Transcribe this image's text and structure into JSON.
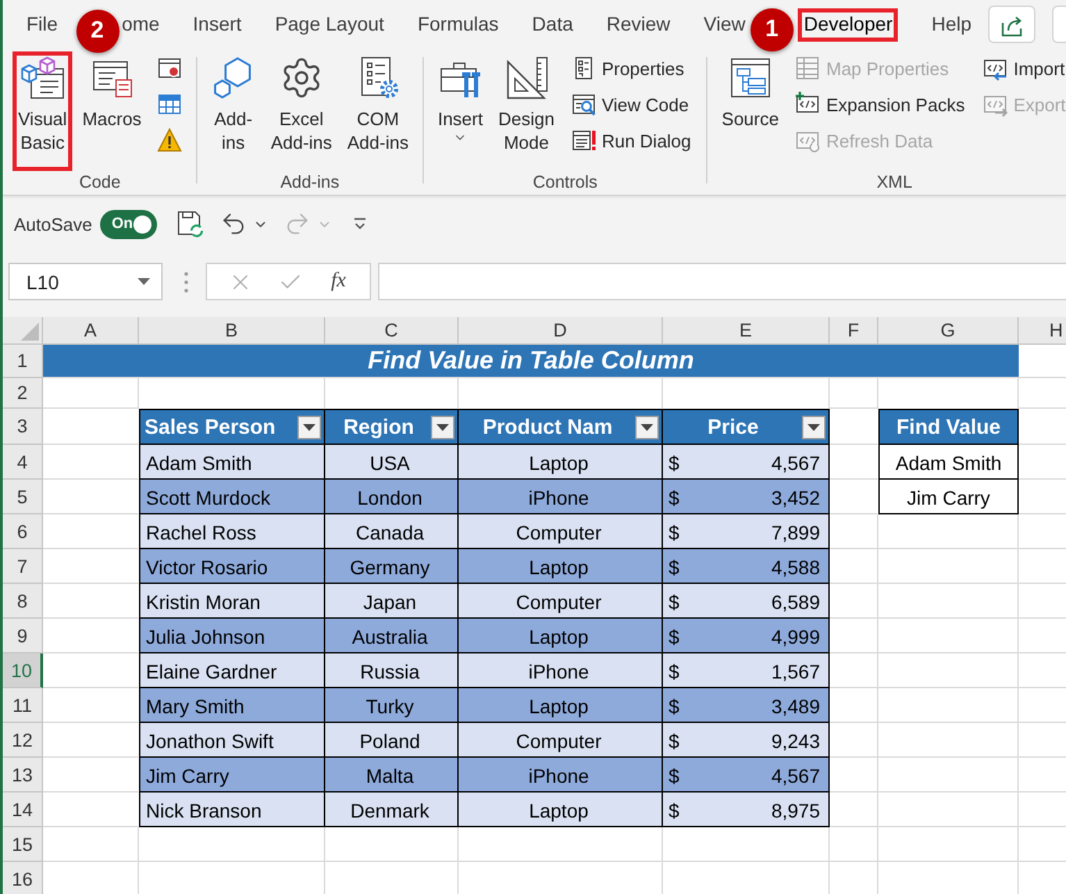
{
  "ribbon": {
    "tabs": [
      {
        "label": "File",
        "selected": false,
        "highlighted": false
      },
      {
        "label": "ome",
        "selected": false,
        "highlighted": false
      },
      {
        "label": "Insert",
        "selected": false,
        "highlighted": false
      },
      {
        "label": "Page Layout",
        "selected": false,
        "highlighted": false
      },
      {
        "label": "Formulas",
        "selected": false,
        "highlighted": false
      },
      {
        "label": "Data",
        "selected": false,
        "highlighted": false
      },
      {
        "label": "Review",
        "selected": false,
        "highlighted": false
      },
      {
        "label": "View",
        "selected": false,
        "highlighted": false
      },
      {
        "label": "Developer",
        "selected": true,
        "highlighted": true,
        "callout": "1"
      },
      {
        "label": "Help",
        "selected": false,
        "highlighted": false
      }
    ],
    "groups": [
      {
        "label": "Code",
        "items": [
          {
            "kind": "large",
            "lines": [
              "Visual",
              "Basic"
            ],
            "highlighted": true,
            "disabled": false,
            "callout": "2"
          },
          {
            "kind": "large",
            "lines": [
              "Macros"
            ],
            "highlighted": false,
            "disabled": false
          },
          {
            "kind": "icon",
            "highlighted": false,
            "disabled": false
          },
          {
            "kind": "icon",
            "highlighted": false,
            "disabled": false
          },
          {
            "kind": "icon",
            "highlighted": false,
            "disabled": false
          }
        ]
      },
      {
        "label": "Add-ins",
        "items": [
          {
            "kind": "large",
            "lines": [
              "Add-",
              "ins"
            ],
            "highlighted": false,
            "disabled": false
          },
          {
            "kind": "large",
            "lines": [
              "Excel",
              "Add-ins"
            ],
            "highlighted": false,
            "disabled": false
          },
          {
            "kind": "large",
            "lines": [
              "COM",
              "Add-ins"
            ],
            "highlighted": false,
            "disabled": false
          }
        ]
      },
      {
        "label": "Controls",
        "items": [
          {
            "kind": "dropdown",
            "lines": [
              "Insert"
            ],
            "highlighted": false,
            "disabled": false
          },
          {
            "kind": "large",
            "lines": [
              "Design",
              "Mode"
            ],
            "highlighted": false,
            "disabled": false
          },
          {
            "kind": "small",
            "label": "Properties",
            "highlighted": false,
            "disabled": false
          },
          {
            "kind": "small",
            "label": "View Code",
            "highlighted": false,
            "disabled": false
          },
          {
            "kind": "small",
            "label": "Run Dialog",
            "highlighted": false,
            "disabled": false
          }
        ]
      },
      {
        "label": "XML",
        "items": [
          {
            "kind": "large",
            "lines": [
              "Source"
            ],
            "highlighted": false,
            "disabled": false
          },
          {
            "kind": "small",
            "label": "Map Properties",
            "highlighted": false,
            "disabled": true
          },
          {
            "kind": "small",
            "label": "Expansion Packs",
            "highlighted": false,
            "disabled": false
          },
          {
            "kind": "small",
            "label": "Refresh Data",
            "highlighted": false,
            "disabled": true
          },
          {
            "kind": "small",
            "label": "Import",
            "highlighted": false,
            "disabled": false
          },
          {
            "kind": "small",
            "label": "Export",
            "highlighted": false,
            "disabled": true
          }
        ]
      }
    ]
  },
  "quick_access": {
    "autosave": {
      "label": "AutoSave",
      "state_label": "On",
      "on": true
    },
    "undo": {
      "disabled": false
    },
    "redo": {
      "disabled": true
    }
  },
  "formula_bar": {
    "name_box": "L10",
    "function_label": "fx"
  },
  "sheet": {
    "columns": [
      "A",
      "B",
      "C",
      "D",
      "E",
      "F",
      "G",
      "H"
    ],
    "rows": [
      {
        "label": "1",
        "selected": false
      },
      {
        "label": "2",
        "selected": false
      },
      {
        "label": "3",
        "selected": false
      },
      {
        "label": "4",
        "selected": false
      },
      {
        "label": "5",
        "selected": false
      },
      {
        "label": "6",
        "selected": false
      },
      {
        "label": "7",
        "selected": false
      },
      {
        "label": "8",
        "selected": false
      },
      {
        "label": "9",
        "selected": false
      },
      {
        "label": "10",
        "selected": true
      },
      {
        "label": "11",
        "selected": false
      },
      {
        "label": "12",
        "selected": false
      },
      {
        "label": "13",
        "selected": false
      },
      {
        "label": "14",
        "selected": false
      },
      {
        "label": "15",
        "selected": false
      },
      {
        "label": "16",
        "selected": false
      }
    ],
    "title": "Find Value in Table Column",
    "table": {
      "headers": [
        "Sales Person",
        "Region",
        "Product Nam",
        "Price"
      ],
      "rows": [
        {
          "name": "Adam Smith",
          "region": "USA",
          "product": "Laptop",
          "currency": "$",
          "price": "4,567"
        },
        {
          "name": "Scott Murdock",
          "region": "London",
          "product": "iPhone",
          "currency": "$",
          "price": "3,452"
        },
        {
          "name": "Rachel Ross",
          "region": "Canada",
          "product": "Computer",
          "currency": "$",
          "price": "7,899"
        },
        {
          "name": "Victor Rosario",
          "region": "Germany",
          "product": "Laptop",
          "currency": "$",
          "price": "4,588"
        },
        {
          "name": "Kristin Moran",
          "region": "Japan",
          "product": "Computer",
          "currency": "$",
          "price": "6,589"
        },
        {
          "name": "Julia Johnson",
          "region": "Australia",
          "product": "Laptop",
          "currency": "$",
          "price": "4,999"
        },
        {
          "name": "Elaine Gardner",
          "region": "Russia",
          "product": "iPhone",
          "currency": "$",
          "price": "1,567"
        },
        {
          "name": "Mary Smith",
          "region": "Turky",
          "product": "Laptop",
          "currency": "$",
          "price": "3,489"
        },
        {
          "name": "Jonathon Swift",
          "region": "Poland",
          "product": "Computer",
          "currency": "$",
          "price": "9,243"
        },
        {
          "name": "Jim Carry",
          "region": "Malta",
          "product": "iPhone",
          "currency": "$",
          "price": "4,567"
        },
        {
          "name": "Nick Branson",
          "region": "Denmark",
          "product": "Laptop",
          "currency": "$",
          "price": "8,975"
        }
      ]
    },
    "lookup": {
      "header": "Find Value",
      "values": [
        "Adam Smith",
        "Jim Carry"
      ]
    }
  }
}
